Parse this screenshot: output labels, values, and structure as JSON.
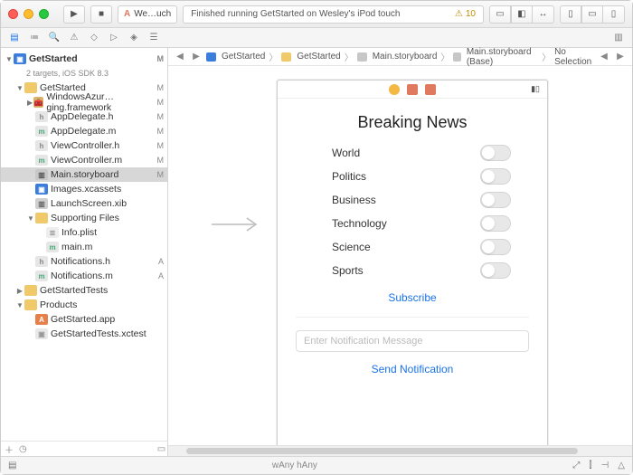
{
  "toolbar": {
    "scheme_label": "We…uch",
    "status_text": "Finished running GetStarted on Wesley's iPod touch",
    "warning_count": "10"
  },
  "navigator": {
    "project": "GetStarted",
    "project_sub": "2 targets, iOS SDK 8.3",
    "tree": [
      {
        "indent": 1,
        "disclose": "▼",
        "icon": "folder",
        "label": "GetStarted",
        "status": "M"
      },
      {
        "indent": 2,
        "disclose": "▶",
        "icon": "frame",
        "label": "WindowsAzur…ging.framework",
        "status": "M"
      },
      {
        "indent": 2,
        "disclose": "",
        "icon": "h",
        "label": "AppDelegate.h",
        "status": "M"
      },
      {
        "indent": 2,
        "disclose": "",
        "icon": "m",
        "label": "AppDelegate.m",
        "status": "M"
      },
      {
        "indent": 2,
        "disclose": "",
        "icon": "h",
        "label": "ViewController.h",
        "status": "M"
      },
      {
        "indent": 2,
        "disclose": "",
        "icon": "m",
        "label": "ViewController.m",
        "status": "M"
      },
      {
        "indent": 2,
        "disclose": "",
        "icon": "story",
        "label": "Main.storyboard",
        "status": "M",
        "selected": true
      },
      {
        "indent": 2,
        "disclose": "",
        "icon": "xc",
        "label": "Images.xcassets",
        "status": ""
      },
      {
        "indent": 2,
        "disclose": "",
        "icon": "xib",
        "label": "LaunchScreen.xib",
        "status": ""
      },
      {
        "indent": 2,
        "disclose": "▼",
        "icon": "folder",
        "label": "Supporting Files",
        "status": ""
      },
      {
        "indent": 3,
        "disclose": "",
        "icon": "plist",
        "label": "Info.plist",
        "status": ""
      },
      {
        "indent": 3,
        "disclose": "",
        "icon": "m",
        "label": "main.m",
        "status": ""
      },
      {
        "indent": 2,
        "disclose": "",
        "icon": "h",
        "label": "Notifications.h",
        "status": "A"
      },
      {
        "indent": 2,
        "disclose": "",
        "icon": "m",
        "label": "Notifications.m",
        "status": "A"
      },
      {
        "indent": 1,
        "disclose": "▶",
        "icon": "folder",
        "label": "GetStartedTests",
        "status": ""
      },
      {
        "indent": 1,
        "disclose": "▼",
        "icon": "folder",
        "label": "Products",
        "status": ""
      },
      {
        "indent": 2,
        "disclose": "",
        "icon": "app",
        "label": "GetStarted.app",
        "status": ""
      },
      {
        "indent": 2,
        "disclose": "",
        "icon": "xctest",
        "label": "GetStartedTests.xctest",
        "status": ""
      }
    ],
    "filter_placeholder": ""
  },
  "jumpbar": {
    "items": [
      "GetStarted",
      "GetStarted",
      "Main.storyboard",
      "Main.storyboard (Base)",
      "No Selection"
    ]
  },
  "storyboard": {
    "title": "Breaking News",
    "toggles": [
      "World",
      "Politics",
      "Business",
      "Technology",
      "Science",
      "Sports"
    ],
    "subscribe_label": "Subscribe",
    "notification_placeholder": "Enter Notification Message",
    "send_label": "Send Notification"
  },
  "bottom": {
    "size_class": "wAny hAny"
  }
}
